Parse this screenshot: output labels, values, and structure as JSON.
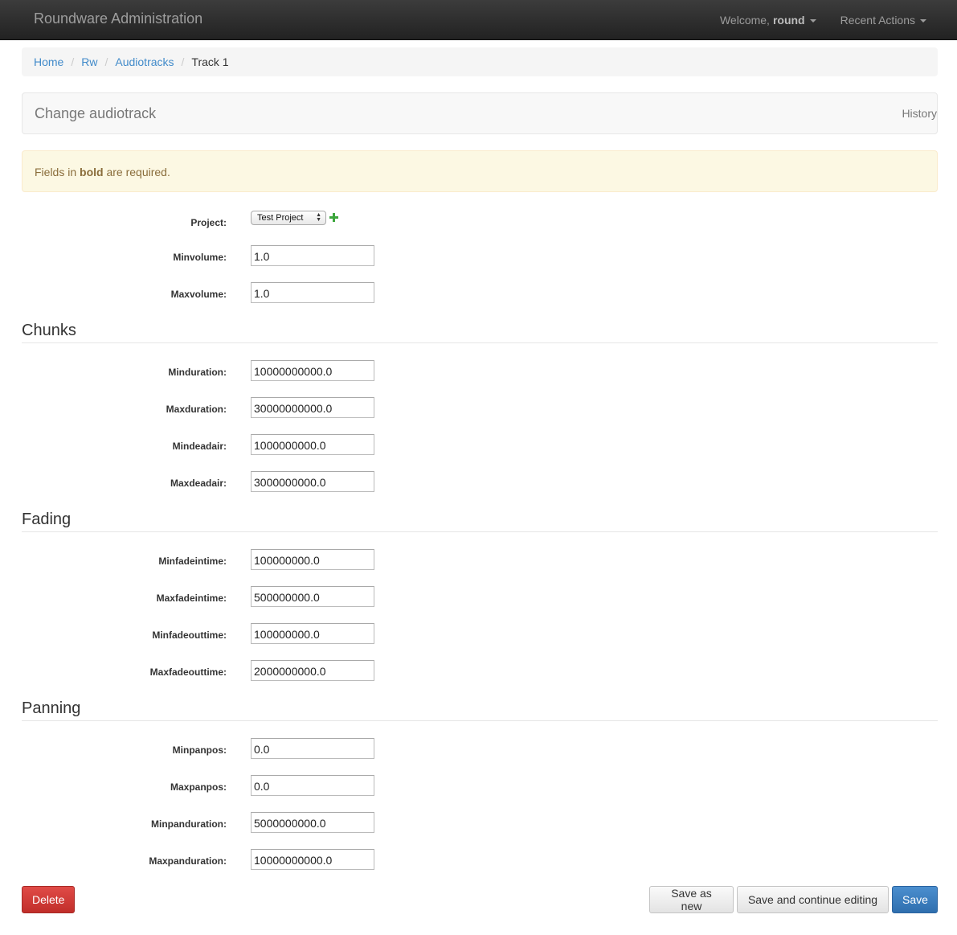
{
  "navbar": {
    "brand": "Roundware Administration",
    "welcome_prefix": "Welcome,",
    "username": "round",
    "recent_actions": "Recent Actions"
  },
  "breadcrumb": {
    "items": [
      "Home",
      "Rw",
      "Audiotracks"
    ],
    "separator": "/",
    "current": "Track 1"
  },
  "header": {
    "title": "Change audiotrack",
    "history": "History"
  },
  "alert": {
    "prefix": "Fields in",
    "bold": "bold",
    "suffix": "are required."
  },
  "form": {
    "project": {
      "label": "Project:",
      "selected": "Test Project"
    },
    "minvolume": {
      "label": "Minvolume:",
      "value": "1.0"
    },
    "maxvolume": {
      "label": "Maxvolume:",
      "value": "1.0"
    }
  },
  "sections": {
    "chunks": {
      "title": "Chunks",
      "minduration": {
        "label": "Minduration:",
        "value": "10000000000.0"
      },
      "maxduration": {
        "label": "Maxduration:",
        "value": "30000000000.0"
      },
      "mindeadair": {
        "label": "Mindeadair:",
        "value": "1000000000.0"
      },
      "maxdeadair": {
        "label": "Maxdeadair:",
        "value": "3000000000.0"
      }
    },
    "fading": {
      "title": "Fading",
      "minfadeintime": {
        "label": "Minfadeintime:",
        "value": "100000000.0"
      },
      "maxfadeintime": {
        "label": "Maxfadeintime:",
        "value": "500000000.0"
      },
      "minfadeouttime": {
        "label": "Minfadeouttime:",
        "value": "100000000.0"
      },
      "maxfadeouttime": {
        "label": "Maxfadeouttime:",
        "value": "2000000000.0"
      }
    },
    "panning": {
      "title": "Panning",
      "minpanpos": {
        "label": "Minpanpos:",
        "value": "0.0"
      },
      "maxpanpos": {
        "label": "Maxpanpos:",
        "value": "0.0"
      },
      "minpanduration": {
        "label": "Minpanduration:",
        "value": "5000000000.0"
      },
      "maxpanduration": {
        "label": "Maxpanduration:",
        "value": "10000000000.0"
      }
    }
  },
  "buttons": {
    "delete": "Delete",
    "save_as_new": "Save as new",
    "save_and_continue": "Save and continue editing",
    "save": "Save"
  },
  "colors": {
    "navbar_bg": "#222222",
    "link": "#428bca",
    "alert_bg": "#fcf8e3",
    "alert_text": "#8a6d3b",
    "delete_btn": "#d9534f",
    "save_btn": "#357ebd",
    "add_icon": "#3ca63c"
  },
  "icons": {
    "caret": "chevron-down-icon",
    "add_related": "plus-icon",
    "select_arrows": "up-down-arrows-icon"
  }
}
